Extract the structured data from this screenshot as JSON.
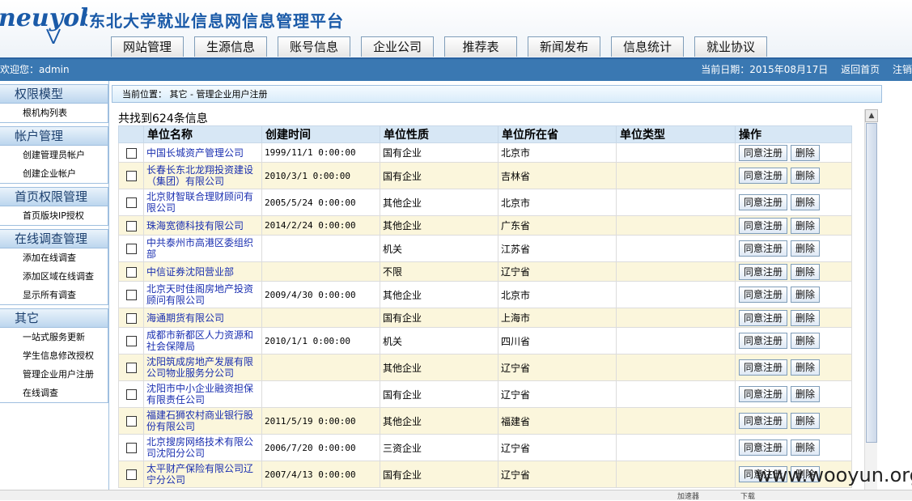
{
  "header": {
    "logo_text": "neuyob",
    "site_title": "东北大学就业信息网信息管理平台"
  },
  "nav": {
    "tabs": [
      "网站管理",
      "生源信息",
      "账号信息",
      "企业公司",
      "推荐表",
      "新闻发布",
      "信息统计",
      "就业协议"
    ]
  },
  "topbar": {
    "welcome": "欢迎您：admin",
    "date": "当前日期：2015年08月17日",
    "home": "返回首页",
    "logout": "注销"
  },
  "sidebar": {
    "groups": [
      {
        "title": "权限模型",
        "items": [
          "根机构列表"
        ]
      },
      {
        "title": "帐户管理",
        "items": [
          "创建管理员帐户",
          "创建企业帐户"
        ]
      },
      {
        "title": "首页权限管理",
        "items": [
          "首页版块IP授权"
        ]
      },
      {
        "title": "在线调查管理",
        "items": [
          "添加在线调查",
          "添加区域在线调查",
          "显示所有调查"
        ]
      },
      {
        "title": "其它",
        "items": [
          "一站式服务更新",
          "学生信息修改授权",
          "管理企业用户注册",
          "在线调查"
        ]
      }
    ]
  },
  "breadcrumb": "当前位置：  其它 -  管理企业用户注册",
  "found_text": "共找到624条信息",
  "table": {
    "headers": [
      "单位名称",
      "创建时间",
      "单位性质",
      "单位所在省",
      "单位类型",
      "操作"
    ],
    "approve_label": "同意注册",
    "delete_label": "删除",
    "rows": [
      {
        "name": "中国长城资产管理公司",
        "time": "1999/11/1 0:00:00",
        "nature": "国有企业",
        "province": "北京市",
        "type": ""
      },
      {
        "name": "长春长东北龙翔投资建设（集团）有限公司",
        "time": "2010/3/1 0:00:00",
        "nature": "国有企业",
        "province": "吉林省",
        "type": ""
      },
      {
        "name": "北京财智联合理财顾问有限公司",
        "time": "2005/5/24 0:00:00",
        "nature": "其他企业",
        "province": "北京市",
        "type": ""
      },
      {
        "name": "珠海宽德科技有限公司",
        "time": "2014/2/24 0:00:00",
        "nature": "其他企业",
        "province": "广东省",
        "type": ""
      },
      {
        "name": "中共泰州市高港区委组织部",
        "time": "",
        "nature": "机关",
        "province": "江苏省",
        "type": ""
      },
      {
        "name": "中信证券沈阳营业部",
        "time": "",
        "nature": "不限",
        "province": "辽宁省",
        "type": ""
      },
      {
        "name": "北京天时佳阁房地产投资顾问有限公司",
        "time": "2009/4/30 0:00:00",
        "nature": "其他企业",
        "province": "北京市",
        "type": ""
      },
      {
        "name": "海通期货有限公司",
        "time": "",
        "nature": "国有企业",
        "province": "上海市",
        "type": ""
      },
      {
        "name": "成都市新都区人力资源和社会保障局",
        "time": "2010/1/1 0:00:00",
        "nature": "机关",
        "province": "四川省",
        "type": ""
      },
      {
        "name": "沈阳筑成房地产发展有限公司物业服务分公司",
        "time": "",
        "nature": "其他企业",
        "province": "辽宁省",
        "type": ""
      },
      {
        "name": "沈阳市中小企业融资担保有限责任公司",
        "time": "",
        "nature": "国有企业",
        "province": "辽宁省",
        "type": ""
      },
      {
        "name": "福建石狮农村商业银行股份有限公司",
        "time": "2011/5/19 0:00:00",
        "nature": "其他企业",
        "province": "福建省",
        "type": ""
      },
      {
        "name": "北京搜房网络技术有限公司沈阳分公司",
        "time": "2006/7/20 0:00:00",
        "nature": "三资企业",
        "province": "辽宁省",
        "type": ""
      },
      {
        "name": "太平财产保险有限公司辽宁分公司",
        "time": "2007/4/13 0:00:00",
        "nature": "国有企业",
        "province": "辽宁省",
        "type": ""
      }
    ]
  },
  "statusbar": {
    "speed": "加速器",
    "download": "下载"
  },
  "watermark": "www.wooyun.org"
}
